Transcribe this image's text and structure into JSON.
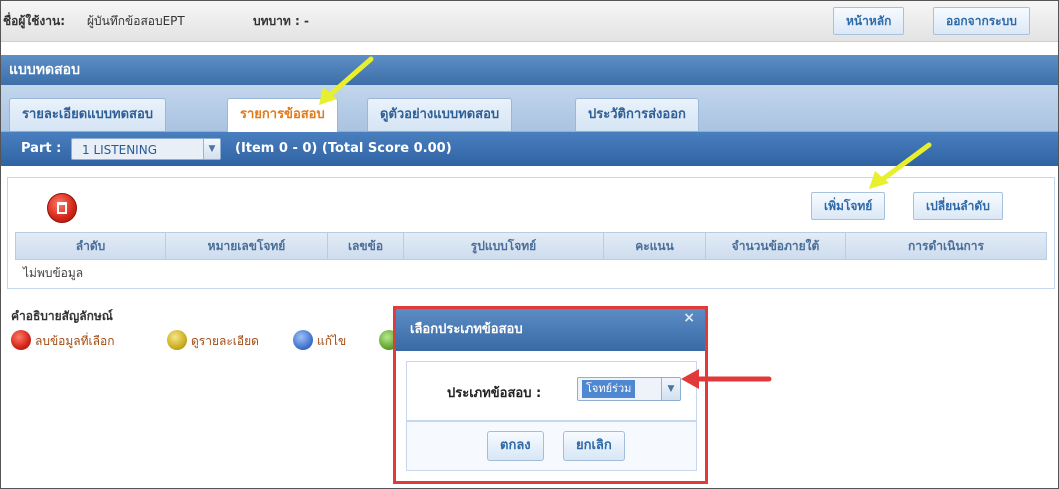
{
  "topbar": {
    "user_label": "ชื่อผู้ใช้งาน:",
    "user_name": "ผู้บันทึกข้อสอบEPT",
    "role_label": "บทบาท : -",
    "home_button": "หน้าหลัก",
    "logout_button": "ออกจากระบบ"
  },
  "header": {
    "title": "แบบทดสอบ"
  },
  "tabs": [
    {
      "label": "รายละเอียดแบบทดสอบ",
      "active": false
    },
    {
      "label": "รายการข้อสอบ",
      "active": true
    },
    {
      "label": "ดูตัวอย่างแบบทดสอบ",
      "active": false
    },
    {
      "label": "ประวัติการส่งออก",
      "active": false
    }
  ],
  "part_bar": {
    "label": "Part :",
    "selected": "1 LISTENING",
    "item_info": "(Item 0 - 0) (Total Score 0.00)"
  },
  "actions": {
    "add_question": "เพิ่มโจทย์",
    "reorder": "เปลี่ยนลำดับ"
  },
  "table": {
    "columns": [
      "ลำดับ",
      "หมายเลขโจทย์",
      "เลขข้อ",
      "รูปแบบโจทย์",
      "คะแนน",
      "จำนวนข้อภายใต้",
      "การดำเนินการ"
    ],
    "empty_text": "ไม่พบข้อมูล"
  },
  "legend": {
    "title": "คำอธิบายสัญลักษณ์",
    "items": [
      {
        "icon": "delete-icon",
        "label": "ลบข้อมูลที่เลือก"
      },
      {
        "icon": "view-detail-icon",
        "label": "ดูรายละเอียด"
      },
      {
        "icon": "edit-icon",
        "label": "แก้ไข"
      }
    ]
  },
  "dialog": {
    "title": "เลือกประเภทข้อสอบ",
    "close": "×",
    "type_label": "ประเภทข้อสอบ :",
    "type_value": "โจทย์ร่วม",
    "ok_button": "ตกลง",
    "cancel_button": "ยกเลิก"
  },
  "annotation_colors": {
    "highlight_arrow": "#e8ef2c",
    "pointer_arrow": "#e03a3a"
  }
}
